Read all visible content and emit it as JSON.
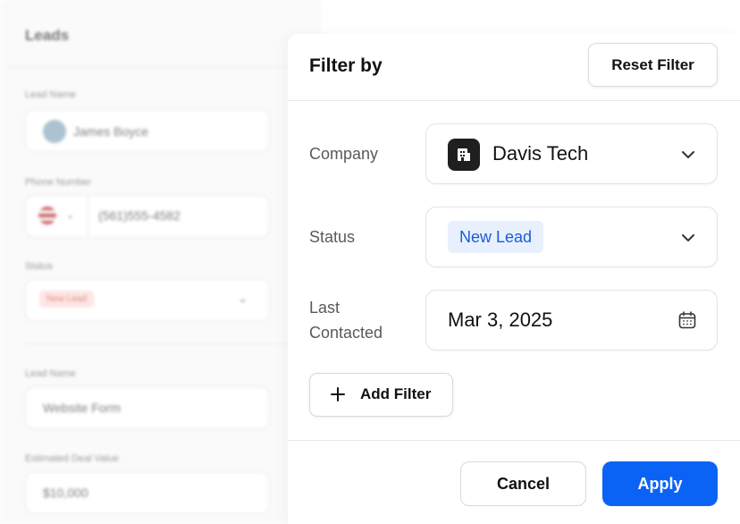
{
  "background_form": {
    "title": "Leads",
    "lead_name_label": "Lead Name",
    "lead_name_value": "James Boyce",
    "phone_label": "Phone Number",
    "phone_value": "(561)555-4582",
    "status_label": "Status",
    "status_value": "New Lead",
    "source_label": "Lead Name",
    "source_value": "Website Form",
    "deal_label": "Estimated Deal Value",
    "deal_value": "$10,000"
  },
  "filter_panel": {
    "title": "Filter by",
    "reset_label": "Reset Filter",
    "company": {
      "label": "Company",
      "value": "Davis Tech",
      "logo_icon": "building-icon"
    },
    "status": {
      "label": "Status",
      "value": "New Lead",
      "badge_color": "#1a5cd6",
      "badge_bg": "#e8f0fe"
    },
    "last_contacted": {
      "label_line1": "Last",
      "label_line2": "Contacted",
      "value": "Mar 3, 2025",
      "icon": "calendar-icon"
    },
    "add_filter_label": "Add Filter",
    "cancel_label": "Cancel",
    "apply_label": "Apply",
    "accent_color": "#0b63f6"
  }
}
